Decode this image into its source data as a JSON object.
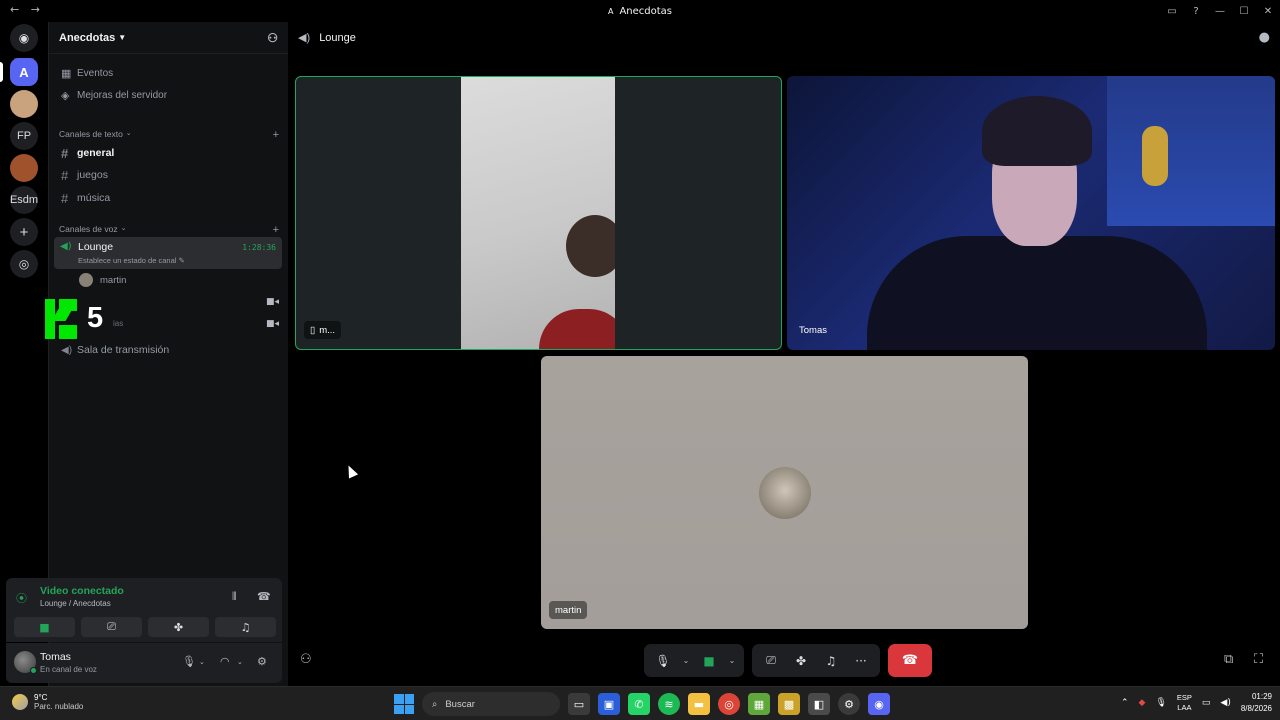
{
  "titlebar": {
    "back": "←",
    "forward": "→",
    "app_initial": "A",
    "title": "Anecdotas",
    "icons": [
      "inbox-icon",
      "help-icon"
    ],
    "minimize": "—",
    "maximize": "☐",
    "close": "✕"
  },
  "rail": {
    "servers": [
      {
        "label": "A",
        "name": "Anecdotas",
        "active": true
      },
      {
        "label": "FP"
      },
      {
        "label": "Esdm"
      }
    ]
  },
  "sidebar": {
    "server_name": "Anecdotas",
    "events": "Eventos",
    "boosts": "Mejoras del servidor",
    "text_category": "Canales de texto",
    "text_channels": [
      "general",
      "juegos",
      "música"
    ],
    "voice_category": "Canales de voz",
    "voice_channel": {
      "name": "Lounge",
      "status": "Establece un estado de canal",
      "duration": "1:28:36",
      "users": [
        "martin"
      ]
    },
    "overlay_number": "5",
    "overlay_text": "ias",
    "stage_channel": "Sala de transmisión"
  },
  "voice_panel": {
    "status": "Video conectado",
    "location": "Lounge / Anecdotas"
  },
  "user_panel": {
    "name": "Tomas",
    "status": "En canal de voz"
  },
  "main": {
    "channel_title": "Lounge",
    "tiles": [
      {
        "label": "m..."
      },
      {
        "label": "Tomas"
      },
      {
        "label": "martin"
      }
    ]
  },
  "taskbar": {
    "weather_temp": "9°C",
    "weather_desc": "Parc. nublado",
    "search_placeholder": "Buscar",
    "lang_top": "ESP",
    "lang_bottom": "LAA",
    "time": "01:29",
    "date": "8/8/2026"
  },
  "colors": {
    "accent": "#5865f2",
    "connected_green": "#23a559",
    "hangup_red": "#da373c"
  }
}
